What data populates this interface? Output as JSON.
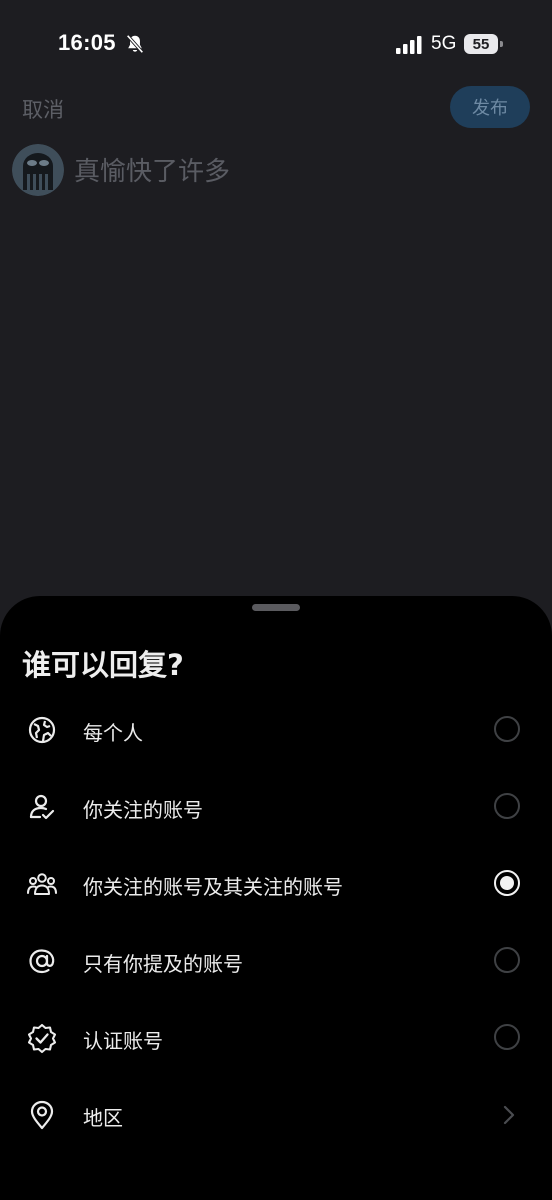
{
  "status_bar": {
    "time": "16:05",
    "network": "5G",
    "battery": "55"
  },
  "compose": {
    "cancel_label": "取消",
    "post_label": "发布",
    "text": "真愉快了许多"
  },
  "reply_sheet": {
    "title": "谁可以回复?",
    "options": [
      {
        "label": "每个人",
        "icon": "globe-icon",
        "selected": false
      },
      {
        "label": "你关注的账号",
        "icon": "user-check-icon",
        "selected": false
      },
      {
        "label": "你关注的账号及其关注的账号",
        "icon": "users-icon",
        "selected": true
      },
      {
        "label": "只有你提及的账号",
        "icon": "at-icon",
        "selected": false
      },
      {
        "label": "认证账号",
        "icon": "verified-badge-icon",
        "selected": false
      },
      {
        "label": "地区",
        "icon": "location-pin-icon",
        "selected": false
      }
    ]
  },
  "colors": {
    "background": "#1d1d21",
    "sheet": "#000000",
    "post_button": "#1f3e5a"
  }
}
